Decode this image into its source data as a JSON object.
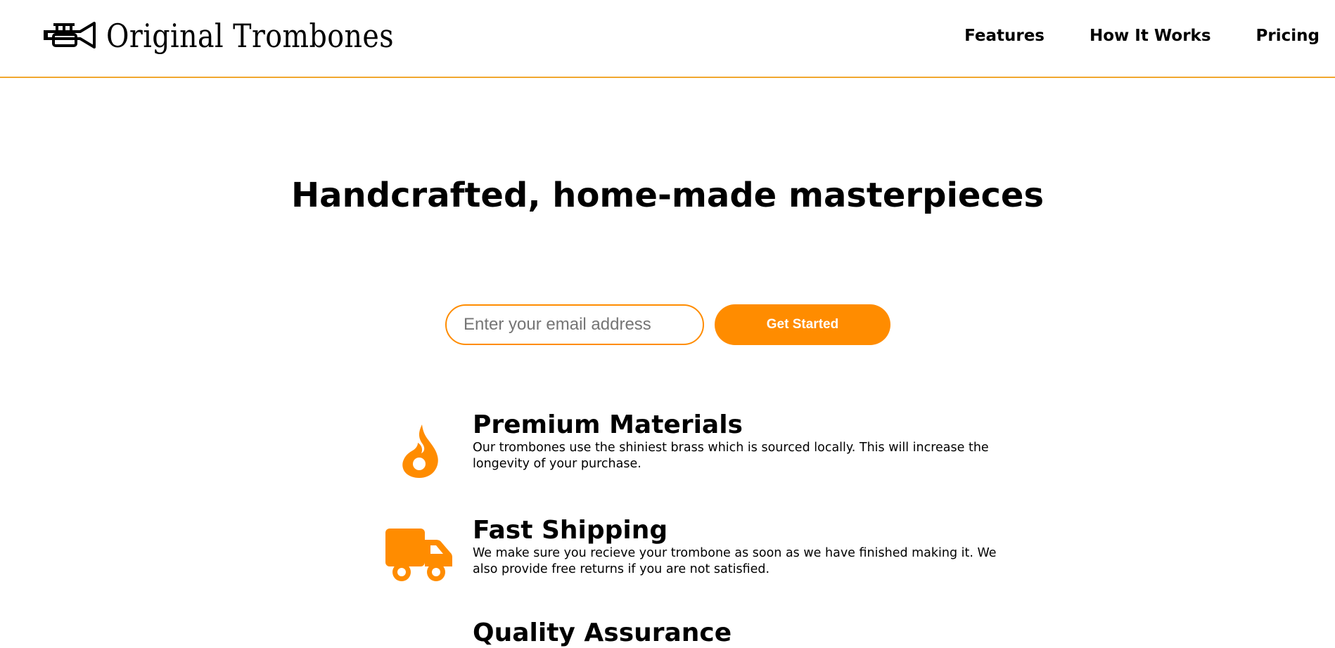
{
  "brand": {
    "name": "Original Trombones",
    "icon": "trumpet-icon"
  },
  "nav": {
    "items": [
      "Features",
      "How It Works",
      "Pricing"
    ]
  },
  "hero": {
    "title": "Handcrafted, home-made masterpieces"
  },
  "signup": {
    "email_placeholder": "Enter your email address",
    "email_value": "",
    "button_label": "Get Started"
  },
  "features": [
    {
      "icon": "fire-icon",
      "title": "Premium Materials",
      "description": "Our trombones use the shiniest brass which is sourced locally. This will increase the longevity of your purchase."
    },
    {
      "icon": "truck-icon",
      "title": "Fast Shipping",
      "description": "We make sure you recieve your trombone as soon as we have finished making it. We also provide free returns if you are not satisfied."
    },
    {
      "icon": "",
      "title": "Quality Assurance",
      "description": ""
    }
  ],
  "colors": {
    "accent": "#ff8c00",
    "header_border": "#f1a72f",
    "text": "#000000",
    "background": "#ffffff"
  }
}
